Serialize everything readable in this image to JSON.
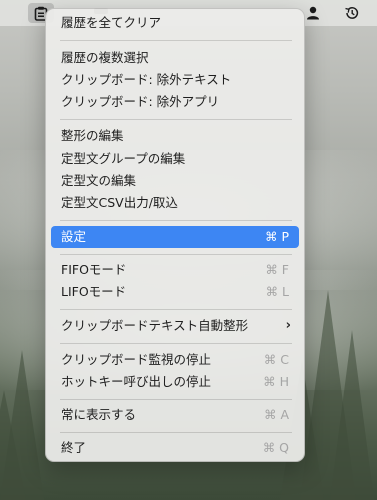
{
  "menu": {
    "items": [
      {
        "label": "履歴を全てクリア",
        "shortcut": ""
      },
      {
        "label": "履歴の複数選択",
        "shortcut": ""
      },
      {
        "label": "クリップボード: 除外テキスト",
        "shortcut": ""
      },
      {
        "label": "クリップボード: 除外アプリ",
        "shortcut": ""
      },
      {
        "label": "整形の編集",
        "shortcut": ""
      },
      {
        "label": "定型文グループの編集",
        "shortcut": ""
      },
      {
        "label": "定型文の編集",
        "shortcut": ""
      },
      {
        "label": "定型文CSV出力/取込",
        "shortcut": ""
      },
      {
        "label": "設定",
        "shortcut": "⌘ P",
        "selected": true
      },
      {
        "label": "FIFOモード",
        "shortcut": "⌘ F"
      },
      {
        "label": "LIFOモード",
        "shortcut": "⌘ L"
      },
      {
        "label": "クリップボードテキスト自動整形",
        "shortcut": "",
        "submenu_indicator": "›"
      },
      {
        "label": "クリップボード監視の停止",
        "shortcut": "⌘ C"
      },
      {
        "label": "ホットキー呼び出しの停止",
        "shortcut": "⌘ H"
      },
      {
        "label": "常に表示する",
        "shortcut": "⌘ A"
      },
      {
        "label": "終了",
        "shortcut": "⌘ Q"
      }
    ]
  },
  "menubar": {
    "icons": [
      "clipboard-icon",
      "app-icon",
      "person-icon",
      "history-icon"
    ]
  },
  "colors": {
    "selection": "#3d86f3",
    "menu_background": "#ececea",
    "shortcut_text": "#a5a5a5"
  }
}
